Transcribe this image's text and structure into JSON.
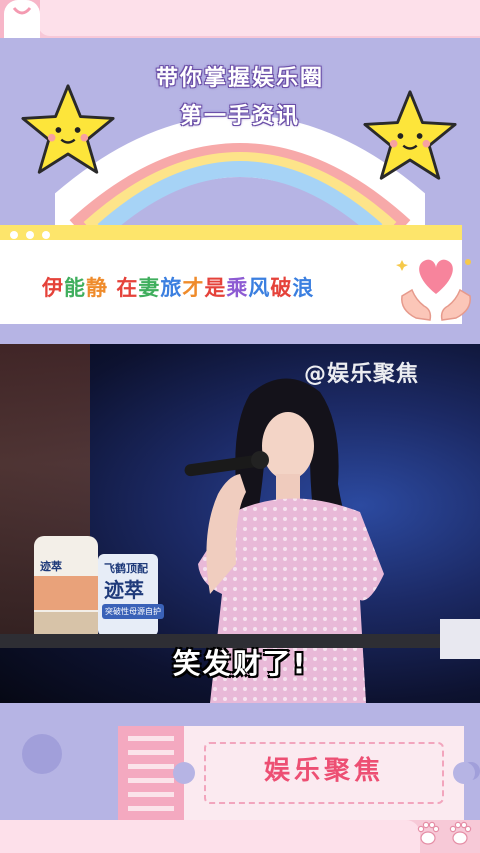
{
  "header": {
    "line1": "带你掌握娱乐圈",
    "line2": "第一手资讯"
  },
  "title": {
    "segments": [
      {
        "text": "伊",
        "color": "#e5423a"
      },
      {
        "text": "能",
        "color": "#3fae5d"
      },
      {
        "text": "静 ",
        "color": "#ef8b2b"
      },
      {
        "text": "在",
        "color": "#e5423a"
      },
      {
        "text": "妻",
        "color": "#3fae5d"
      },
      {
        "text": "旅",
        "color": "#3b7fe0"
      },
      {
        "text": "才",
        "color": "#ef8b2b"
      },
      {
        "text": "是",
        "color": "#e5423a"
      },
      {
        "text": "乘",
        "color": "#8d5bd3"
      },
      {
        "text": "风",
        "color": "#3b7fe0"
      },
      {
        "text": "破",
        "color": "#e5423a"
      },
      {
        "text": "浪",
        "color": "#3b7fe0"
      }
    ]
  },
  "video": {
    "watermark": "@娱乐聚焦",
    "subtitle": "笑发财了!",
    "promo": {
      "line1": "飞鹤顶配",
      "line2": "迹萃",
      "line3": "突破性母源自护",
      "can_label": "迹萃"
    }
  },
  "footer": {
    "ticket_text": "娱乐聚焦"
  },
  "colors": {
    "lavender": "#b6b4e4",
    "pink": "#f8c8d8",
    "yellow": "#fde56b",
    "ticket_text": "#ed4f73"
  }
}
